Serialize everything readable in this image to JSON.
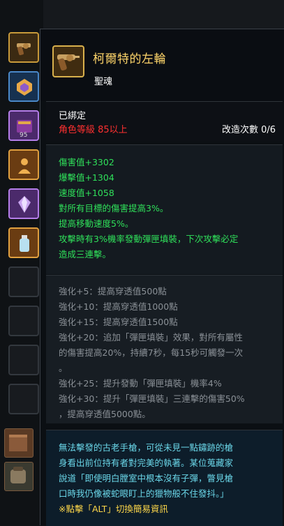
{
  "item": {
    "name": "柯爾特的左輪",
    "rarity": "聖魂",
    "bound": "已綁定",
    "level_requirement": "角色等級 85以上",
    "modify_count": "改造次數 0/6"
  },
  "stats": [
    "傷害值+3302",
    "爆擊值+1304",
    "速度值+1058",
    "對所有目標的傷害提高3%。",
    "提高移動速度5%。",
    "攻擊時有3%機率發動彈匣填裝，下次攻擊必定",
    "造成三連擊。"
  ],
  "enhancements": [
    "強化+5：提高穿透值500點",
    "強化+10：提高穿透值1000點",
    "強化+15：提高穿透值1500點",
    "強化+20：追加「彈匣填裝」效果，對所有屬性",
    "的傷害提高20%，持續7秒，每15秒可觸發一次",
    "。",
    "強化+25：提升發動「彈匣填裝」機率4%",
    "強化+30：提升「彈匣填裝」三連擊的傷害50%",
    "，提高穿透值5000點。"
  ],
  "description": [
    "無法擊發的古老手槍，可從未見一點鏽跡的槍",
    "身看出前位持有者對完美的執著。某位蒐藏家",
    "說道「即使明白膛室中根本沒有子彈，瞥見槍",
    "口時我仍像被蛇眼盯上的獵物般不住發抖。」"
  ],
  "alt_hint": "※點擊「ALT」切換簡易資訊",
  "inventory": {
    "slot_count": "95"
  },
  "colors": {
    "name": "#ffd56a",
    "stat": "#2fe05a",
    "level_req": "#ff3030",
    "enhance": "#8a9096",
    "description": "#6ad6e8",
    "hint": "#ffd84a"
  }
}
